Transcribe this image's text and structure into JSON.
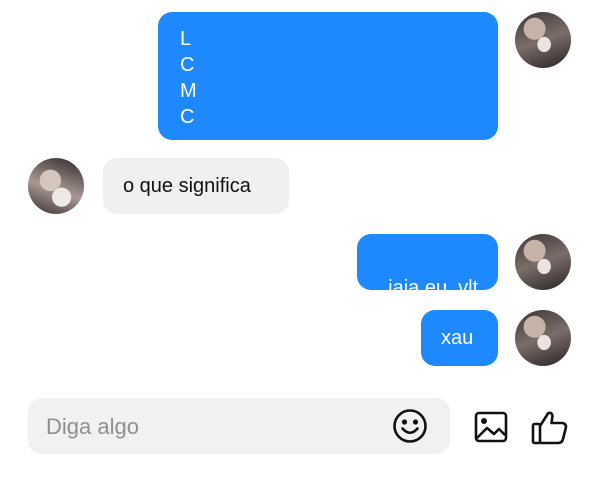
{
  "messages": [
    {
      "direction": "sent",
      "lines": [
        "L",
        "C",
        "M",
        "C"
      ]
    },
    {
      "direction": "received",
      "text": "o que significa"
    },
    {
      "direction": "sent",
      "text": "jaja eu  vlt"
    },
    {
      "direction": "sent",
      "text": "xau"
    }
  ],
  "composer": {
    "placeholder": "Diga algo"
  },
  "icons": {
    "emoji": "smiley-icon",
    "gallery": "image-icon",
    "like": "thumbs-up-icon"
  },
  "colors": {
    "sent_bubble": "#1e88ff",
    "received_bubble": "#f0f0f0",
    "composer_bg": "#f1f1f3"
  }
}
